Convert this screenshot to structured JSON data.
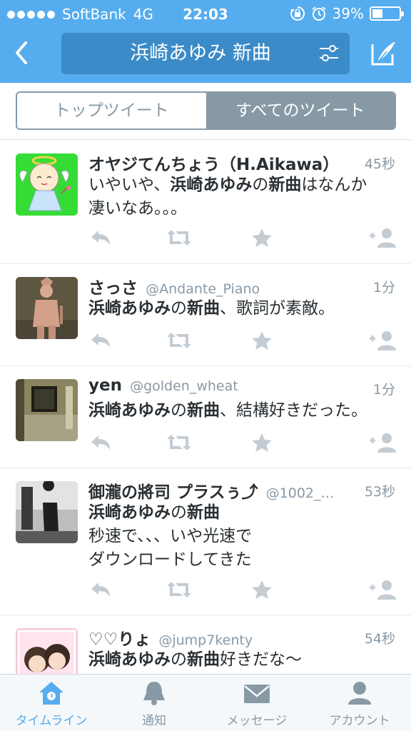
{
  "status": {
    "carrier": "SoftBank",
    "network": "4G",
    "time": "22:03",
    "battery": "39%",
    "battery_level": 0.39
  },
  "nav": {
    "search_query": "浜崎あゆみ 新曲",
    "back_icon": "chevron-left-icon",
    "filter_icon": "sliders-icon",
    "compose_icon": "compose-icon"
  },
  "segments": {
    "top": "トップツイート",
    "all": "すべてのツイート",
    "active": "all"
  },
  "colors": {
    "brand": "#55acee",
    "search_bg": "#3a8bc7",
    "muted": "#8899a6",
    "text": "#292f33"
  },
  "tweets": [
    {
      "name": "オヤジてんちょう（H.Aikawa）",
      "handle": "",
      "time": "45秒",
      "lines": [
        [
          {
            "t": "いやいや、"
          },
          {
            "t": "浜崎あゆみ",
            "b": true
          },
          {
            "t": "の"
          },
          {
            "t": "新曲",
            "b": true
          },
          {
            "t": "はなんか"
          }
        ],
        [
          {
            "t": "凄いなあ。。。"
          }
        ]
      ]
    },
    {
      "name": "さっさ",
      "handle": "@Andante_Piano",
      "time": "1分",
      "lines": [
        [
          {
            "t": "浜崎あゆみ",
            "b": true
          },
          {
            "t": "の"
          },
          {
            "t": "新曲",
            "b": true
          },
          {
            "t": "、歌詞が素敵。"
          }
        ]
      ]
    },
    {
      "name": "yen",
      "handle": "@golden_wheat",
      "time": "1分",
      "lines": [
        [
          {
            "t": "浜崎あゆみ",
            "b": true
          },
          {
            "t": "の"
          },
          {
            "t": "新曲",
            "b": true
          },
          {
            "t": "、結構好きだった。"
          }
        ]
      ]
    },
    {
      "name": "御瀧の將司 プラスぅ⤴",
      "handle": "@1002_…",
      "time": "53秒",
      "lines": [
        [
          {
            "t": "浜崎あゆみ",
            "b": true
          },
          {
            "t": "の"
          },
          {
            "t": "新曲",
            "b": true
          }
        ],
        [
          {
            "t": "秒速で、、、いや光速で"
          }
        ],
        [
          {
            "t": "ダウンロードしてきた"
          }
        ]
      ]
    },
    {
      "name": "♡♡りょ",
      "handle": "@jump7kenty",
      "time": "54秒",
      "lines": [
        [
          {
            "t": "浜崎あゆみ",
            "b": true
          },
          {
            "t": "の"
          },
          {
            "t": "新曲",
            "b": true
          },
          {
            "t": "好きだな〜"
          }
        ]
      ]
    }
  ],
  "tabs": [
    {
      "label": "タイムライン",
      "icon": "home-icon",
      "active": true
    },
    {
      "label": "通知",
      "icon": "bell-icon",
      "active": false
    },
    {
      "label": "メッセージ",
      "icon": "envelope-icon",
      "active": false
    },
    {
      "label": "アカウント",
      "icon": "person-icon",
      "active": false
    }
  ]
}
